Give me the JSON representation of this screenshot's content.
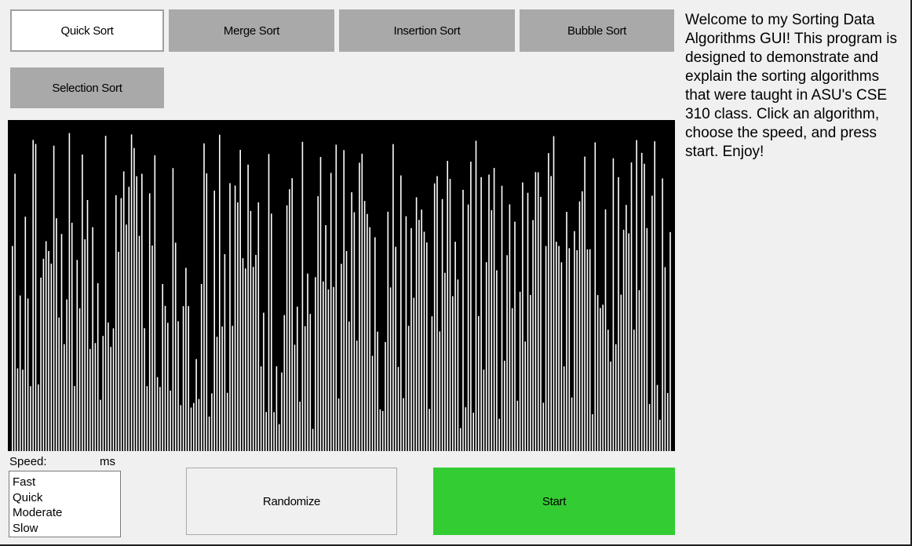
{
  "algorithms": [
    {
      "label": "Quick Sort",
      "selected": true
    },
    {
      "label": "Merge Sort",
      "selected": false
    },
    {
      "label": "Insertion Sort",
      "selected": false
    },
    {
      "label": "Bubble Sort",
      "selected": false
    },
    {
      "label": "Selection Sort",
      "selected": false
    }
  ],
  "description": "Welcome to my Sorting Data Algorithms GUI! This program is designed to demonstrate and explain the sorting algorithms that were taught in ASU's CSE 310 class. Click an algorithm, choose the speed, and press start. Enjoy!",
  "speed": {
    "label": "Speed:",
    "unit": "ms",
    "options": [
      "Fast",
      "Quick",
      "Moderate",
      "Slow"
    ]
  },
  "buttons": {
    "randomize": "Randomize",
    "start": "Start"
  },
  "colors": {
    "canvas_bg": "#000000",
    "bar": "#ffffff",
    "start_bg": "#33cc33",
    "button_bg": "#a9a9a9"
  }
}
